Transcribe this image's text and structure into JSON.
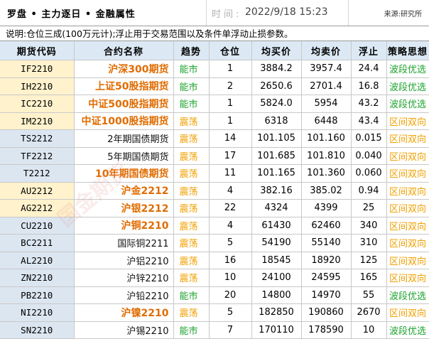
{
  "header": {
    "title": "罗盘 • 主力逐日 • 金融属性",
    "time_label": "时间:",
    "time_value": "2022/9/18 15:23",
    "source": "来源:研究所"
  },
  "note": "说明:仓位三成(100万元计);浮止用于交易范围以及条件单浮动止损参数。",
  "columns": [
    "期货代码",
    "合约名称",
    "趋势",
    "仓位",
    "均买价",
    "均卖价",
    "浮止",
    "策略思想"
  ],
  "colors": {
    "orange": "#e06c00",
    "green": "#1ea32e",
    "amber": "#f0a000",
    "band_a": "#fff2cc",
    "band_b": "#dce6f1"
  },
  "rows": [
    {
      "code": "IF2210",
      "name": "沪深300期货",
      "trend": "能市",
      "pos": "1",
      "buy": "3884.2",
      "sell": "3957.4",
      "stop": "24.4",
      "strategy": "波段优选",
      "band": "a",
      "name_style": "orange",
      "trend_color": "green",
      "strat_color": "green"
    },
    {
      "code": "IH2210",
      "name": "上证50股指期货",
      "trend": "能市",
      "pos": "2",
      "buy": "2650.6",
      "sell": "2701.4",
      "stop": "16.8",
      "strategy": "波段优选",
      "band": "a",
      "name_style": "orange",
      "trend_color": "green",
      "strat_color": "green"
    },
    {
      "code": "IC2210",
      "name": "中证500股指期货",
      "trend": "能市",
      "pos": "1",
      "buy": "5824.0",
      "sell": "5954",
      "stop": "43.2",
      "strategy": "波段优选",
      "band": "a",
      "name_style": "orange",
      "trend_color": "green",
      "strat_color": "green"
    },
    {
      "code": "IM2210",
      "name": "中证1000股指期货",
      "trend": "震荡",
      "pos": "1",
      "buy": "6318",
      "sell": "6448",
      "stop": "43.4",
      "strategy": "区间双向",
      "band": "a",
      "name_style": "orange",
      "trend_color": "amber",
      "strat_color": "amber"
    },
    {
      "code": "TS2212",
      "name": "2年期国债期货",
      "trend": "震荡",
      "pos": "14",
      "buy": "101.105",
      "sell": "101.160",
      "stop": "0.015",
      "strategy": "区间双向",
      "band": "b",
      "name_style": "plain",
      "trend_color": "amber",
      "strat_color": "amber"
    },
    {
      "code": "TF2212",
      "name": "5年期国债期货",
      "trend": "震荡",
      "pos": "17",
      "buy": "101.685",
      "sell": "101.810",
      "stop": "0.040",
      "strategy": "区间双向",
      "band": "b",
      "name_style": "plain",
      "trend_color": "amber",
      "strat_color": "amber"
    },
    {
      "code": "T2212",
      "name": "10年期国债期货",
      "trend": "震荡",
      "pos": "11",
      "buy": "101.165",
      "sell": "101.360",
      "stop": "0.060",
      "strategy": "区间双向",
      "band": "b",
      "name_style": "orange",
      "trend_color": "amber",
      "strat_color": "amber"
    },
    {
      "code": "AU2212",
      "name": "沪金2212",
      "trend": "震荡",
      "pos": "4",
      "buy": "382.16",
      "sell": "385.02",
      "stop": "0.94",
      "strategy": "区间双向",
      "band": "a",
      "name_style": "orange",
      "trend_color": "amber",
      "strat_color": "amber"
    },
    {
      "code": "AG2212",
      "name": "沪银2212",
      "trend": "震荡",
      "pos": "22",
      "buy": "4324",
      "sell": "4399",
      "stop": "25",
      "strategy": "区间双向",
      "band": "a",
      "name_style": "orange",
      "trend_color": "amber",
      "strat_color": "amber"
    },
    {
      "code": "CU2210",
      "name": "沪铜2210",
      "trend": "震荡",
      "pos": "4",
      "buy": "61430",
      "sell": "62460",
      "stop": "340",
      "strategy": "区间双向",
      "band": "b",
      "name_style": "orange",
      "trend_color": "amber",
      "strat_color": "amber"
    },
    {
      "code": "BC2211",
      "name": "国际铜2211",
      "trend": "震荡",
      "pos": "5",
      "buy": "54190",
      "sell": "55140",
      "stop": "310",
      "strategy": "区间双向",
      "band": "b",
      "name_style": "plain",
      "trend_color": "amber",
      "strat_color": "amber"
    },
    {
      "code": "AL2210",
      "name": "沪铝2210",
      "trend": "震荡",
      "pos": "16",
      "buy": "18545",
      "sell": "18920",
      "stop": "125",
      "strategy": "区间双向",
      "band": "b",
      "name_style": "plain",
      "trend_color": "amber",
      "strat_color": "amber"
    },
    {
      "code": "ZN2210",
      "name": "沪锌2210",
      "trend": "震荡",
      "pos": "10",
      "buy": "24100",
      "sell": "24595",
      "stop": "165",
      "strategy": "区间双向",
      "band": "b",
      "name_style": "plain",
      "trend_color": "amber",
      "strat_color": "amber"
    },
    {
      "code": "PB2210",
      "name": "沪铅2210",
      "trend": "能市",
      "pos": "20",
      "buy": "14800",
      "sell": "14970",
      "stop": "55",
      "strategy": "波段优选",
      "band": "b",
      "name_style": "plain",
      "trend_color": "green",
      "strat_color": "green"
    },
    {
      "code": "NI2210",
      "name": "沪镍2210",
      "trend": "震荡",
      "pos": "5",
      "buy": "182850",
      "sell": "190860",
      "stop": "2670",
      "strategy": "区间双向",
      "band": "b",
      "name_style": "orange",
      "trend_color": "amber",
      "strat_color": "amber"
    },
    {
      "code": "SN2210",
      "name": "沪锡2210",
      "trend": "能市",
      "pos": "7",
      "buy": "170110",
      "sell": "178590",
      "stop": "10",
      "strategy": "波段优选",
      "band": "b",
      "name_style": "plain",
      "trend_color": "green",
      "strat_color": "green"
    }
  ]
}
